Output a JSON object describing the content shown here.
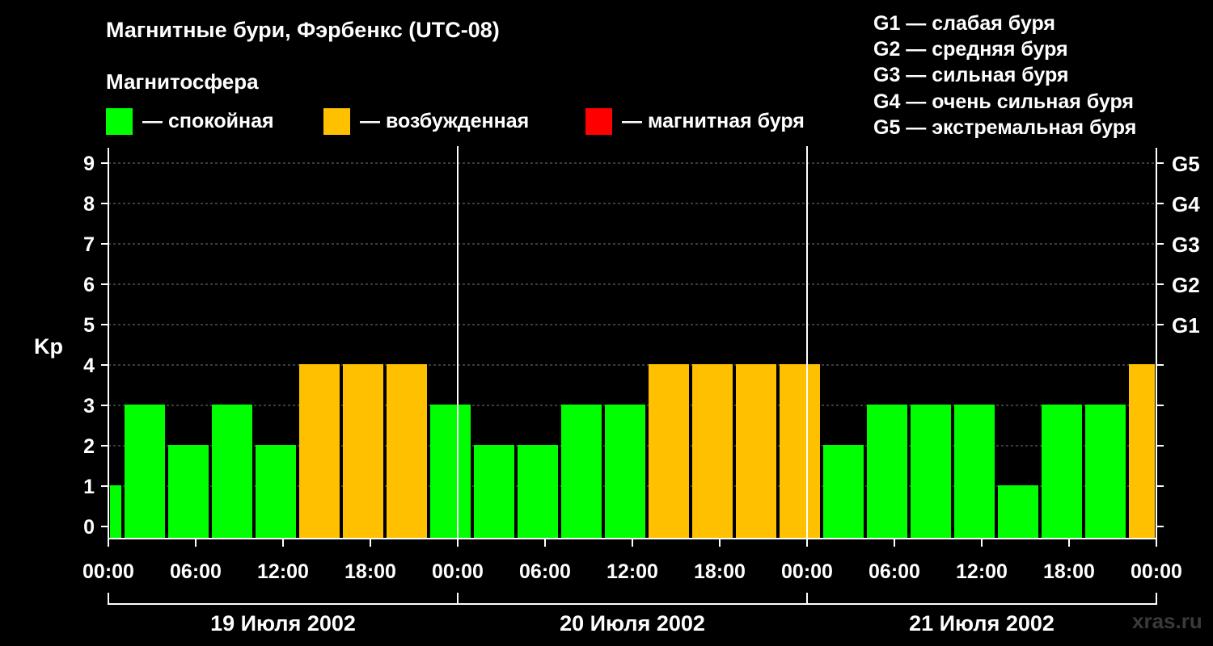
{
  "title": "Магнитные бури, Фэрбенкс (UTC-08)",
  "subtitle": "Магнитосфера",
  "legend": [
    {
      "label": "— спокойная",
      "color": "#00ff00"
    },
    {
      "label": "— возбужденная",
      "color": "#ffc000"
    },
    {
      "label": "— магнитная буря",
      "color": "#ff0000"
    }
  ],
  "g_legend": [
    "G1 — слабая буря",
    "G2 — средняя буря",
    "G3 — сильная буря",
    "G4 — очень сильная буря",
    "G5 — экстремальная буря"
  ],
  "watermark": "xras.ru",
  "chart_data": {
    "type": "bar",
    "ylabel": "Kp",
    "ylim": [
      0,
      9
    ],
    "yticks": [
      "0",
      "1",
      "2",
      "3",
      "4",
      "5",
      "6",
      "7",
      "8",
      "9"
    ],
    "g_levels": [
      {
        "kp": 5,
        "label": "G1"
      },
      {
        "kp": 6,
        "label": "G2"
      },
      {
        "kp": 7,
        "label": "G3"
      },
      {
        "kp": 8,
        "label": "G4"
      },
      {
        "kp": 9,
        "label": "G5"
      }
    ],
    "x_range_hours": [
      0,
      72
    ],
    "xtick_hours": [
      0,
      6,
      12,
      18,
      24,
      30,
      36,
      42,
      48,
      54,
      60,
      66,
      72
    ],
    "xtick_labels": [
      "00:00",
      "06:00",
      "12:00",
      "18:00",
      "00:00",
      "06:00",
      "12:00",
      "18:00",
      "00:00",
      "06:00",
      "12:00",
      "18:00",
      "00:00"
    ],
    "days": [
      "19 Июля 2002",
      "20 Июля 2002",
      "21 Июля 2002"
    ],
    "bars": [
      {
        "start": 0,
        "end": 1,
        "kp": 1,
        "level": "quiet"
      },
      {
        "start": 1,
        "end": 4,
        "kp": 3,
        "level": "quiet"
      },
      {
        "start": 4,
        "end": 7,
        "kp": 2,
        "level": "quiet"
      },
      {
        "start": 7,
        "end": 10,
        "kp": 3,
        "level": "quiet"
      },
      {
        "start": 10,
        "end": 13,
        "kp": 2,
        "level": "quiet"
      },
      {
        "start": 13,
        "end": 16,
        "kp": 4,
        "level": "active"
      },
      {
        "start": 16,
        "end": 19,
        "kp": 4,
        "level": "active"
      },
      {
        "start": 19,
        "end": 22,
        "kp": 4,
        "level": "active"
      },
      {
        "start": 22,
        "end": 25,
        "kp": 3,
        "level": "quiet"
      },
      {
        "start": 25,
        "end": 28,
        "kp": 2,
        "level": "quiet"
      },
      {
        "start": 28,
        "end": 31,
        "kp": 2,
        "level": "quiet"
      },
      {
        "start": 31,
        "end": 34,
        "kp": 3,
        "level": "quiet"
      },
      {
        "start": 34,
        "end": 37,
        "kp": 3,
        "level": "quiet"
      },
      {
        "start": 37,
        "end": 40,
        "kp": 4,
        "level": "active"
      },
      {
        "start": 40,
        "end": 43,
        "kp": 4,
        "level": "active"
      },
      {
        "start": 43,
        "end": 46,
        "kp": 4,
        "level": "active"
      },
      {
        "start": 46,
        "end": 49,
        "kp": 4,
        "level": "active"
      },
      {
        "start": 49,
        "end": 52,
        "kp": 2,
        "level": "quiet"
      },
      {
        "start": 52,
        "end": 55,
        "kp": 3,
        "level": "quiet"
      },
      {
        "start": 55,
        "end": 58,
        "kp": 3,
        "level": "quiet"
      },
      {
        "start": 58,
        "end": 61,
        "kp": 3,
        "level": "quiet"
      },
      {
        "start": 61,
        "end": 64,
        "kp": 1,
        "level": "quiet"
      },
      {
        "start": 64,
        "end": 67,
        "kp": 3,
        "level": "quiet"
      },
      {
        "start": 67,
        "end": 70,
        "kp": 3,
        "level": "quiet"
      },
      {
        "start": 70,
        "end": 72,
        "kp": 4,
        "level": "active"
      }
    ],
    "level_colors": {
      "quiet": "#00ff00",
      "active": "#ffc000",
      "storm": "#ff0000"
    },
    "grid": "dashed horizontal at each Kp level"
  }
}
